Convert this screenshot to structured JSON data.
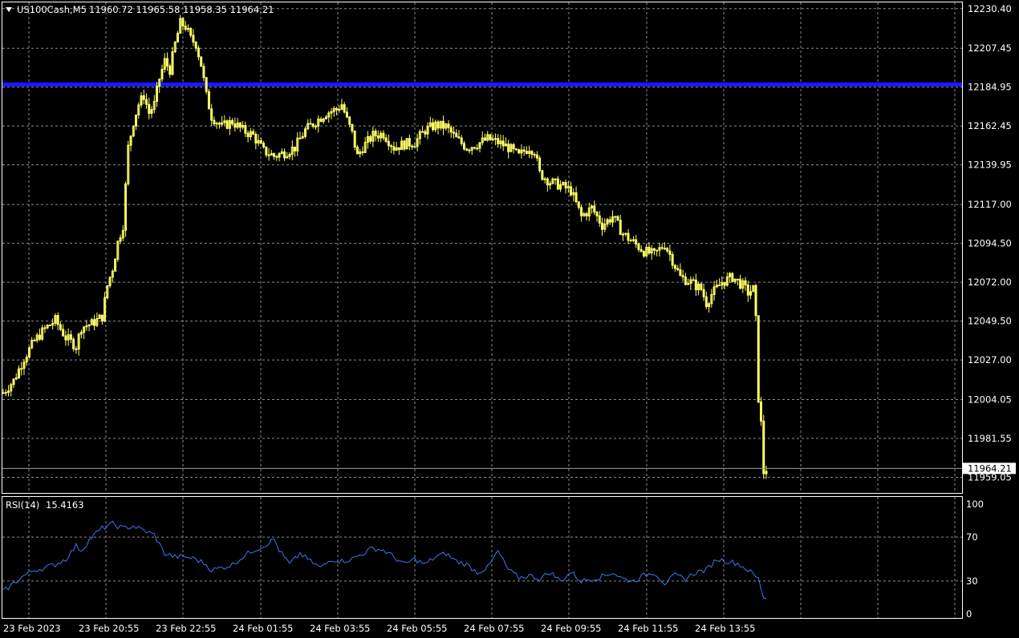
{
  "header": {
    "symbol": "US100Cash,M5",
    "ohlc": "11960.72 11965.58 11958.35 11964.21"
  },
  "colors": {
    "background": "#000000",
    "candle": "#ffff66",
    "hline": "#1a1aff",
    "rsi_line": "#3c78f0",
    "grid": "#8c8c8c"
  },
  "chart_data": [
    {
      "type": "candlestick",
      "name": "US100Cash M5",
      "ylim": [
        11950,
        12234
      ],
      "y_ticks": [
        "12230.40",
        "12207.45",
        "12184.95",
        "12162.45",
        "12139.95",
        "12117.00",
        "12094.50",
        "12072.00",
        "12049.50",
        "12027.00",
        "12004.05",
        "11981.55",
        "11959.05"
      ],
      "x_ticks": [
        "23 Feb 2023",
        "23 Feb 20:55",
        "23 Feb 22:55",
        "24 Feb 01:55",
        "24 Feb 03:55",
        "24 Feb 05:55",
        "24 Feb 07:55",
        "24 Feb 09:55",
        "24 Feb 11:55",
        "24 Feb 13:55"
      ],
      "current_price": "11964.21",
      "horizontal_line": 12186.5,
      "close_path": [
        [
          0,
          12008
        ],
        [
          4,
          12015
        ],
        [
          8,
          12028
        ],
        [
          12,
          12038
        ],
        [
          16,
          12045
        ],
        [
          20,
          12050
        ],
        [
          24,
          12040
        ],
        [
          28,
          12035
        ],
        [
          30,
          12046
        ],
        [
          34,
          12048
        ],
        [
          38,
          12052
        ],
        [
          40,
          12070
        ],
        [
          42,
          12080
        ],
        [
          44,
          12095
        ],
        [
          46,
          12105
        ],
        [
          48,
          12150
        ],
        [
          50,
          12165
        ],
        [
          52,
          12175
        ],
        [
          54,
          12180
        ],
        [
          56,
          12170
        ],
        [
          58,
          12175
        ],
        [
          60,
          12190
        ],
        [
          62,
          12200
        ],
        [
          64,
          12195
        ],
        [
          66,
          12210
        ],
        [
          68,
          12222
        ],
        [
          70,
          12220
        ],
        [
          72,
          12213
        ],
        [
          74,
          12210
        ],
        [
          76,
          12198
        ],
        [
          78,
          12180
        ],
        [
          80,
          12168
        ],
        [
          84,
          12162
        ],
        [
          88,
          12165
        ],
        [
          92,
          12160
        ],
        [
          96,
          12157
        ],
        [
          100,
          12148
        ],
        [
          104,
          12145
        ],
        [
          108,
          12147
        ],
        [
          112,
          12150
        ],
        [
          116,
          12160
        ],
        [
          120,
          12165
        ],
        [
          124,
          12170
        ],
        [
          128,
          12172
        ],
        [
          130,
          12175
        ],
        [
          132,
          12166
        ],
        [
          134,
          12158
        ],
        [
          136,
          12145
        ],
        [
          138,
          12150
        ],
        [
          142,
          12157
        ],
        [
          146,
          12158
        ],
        [
          150,
          12150
        ],
        [
          154,
          12152
        ],
        [
          158,
          12153
        ],
        [
          162,
          12160
        ],
        [
          166,
          12163
        ],
        [
          170,
          12162
        ],
        [
          174,
          12155
        ],
        [
          178,
          12150
        ],
        [
          182,
          12152
        ],
        [
          186,
          12155
        ],
        [
          190,
          12153
        ],
        [
          194,
          12150
        ],
        [
          198,
          12145
        ],
        [
          200,
          12148
        ],
        [
          202,
          12150
        ],
        [
          204,
          12148
        ],
        [
          206,
          12135
        ],
        [
          210,
          12130
        ],
        [
          214,
          12128
        ],
        [
          218,
          12125
        ],
        [
          222,
          12110
        ],
        [
          226,
          12115
        ],
        [
          230,
          12105
        ],
        [
          234,
          12110
        ],
        [
          238,
          12100
        ],
        [
          242,
          12095
        ],
        [
          246,
          12090
        ],
        [
          250,
          12088
        ],
        [
          254,
          12094
        ],
        [
          256,
          12088
        ],
        [
          260,
          12075
        ],
        [
          264,
          12072
        ],
        [
          268,
          12068
        ],
        [
          270,
          12060
        ],
        [
          272,
          12065
        ],
        [
          276,
          12072
        ],
        [
          280,
          12075
        ],
        [
          284,
          12070
        ],
        [
          286,
          12066
        ],
        [
          288,
          12068
        ],
        [
          289,
          12050
        ],
        [
          290,
          12005
        ],
        [
          291,
          11990
        ],
        [
          292,
          11962
        ],
        [
          293,
          11964
        ]
      ]
    },
    {
      "type": "line",
      "name": "RSI(14)",
      "value_label": "15.4163",
      "ylim": [
        0,
        100
      ],
      "y_ticks": [
        "100",
        "70",
        "30",
        "0"
      ],
      "levels": [
        70,
        30
      ],
      "values": [
        [
          0,
          20
        ],
        [
          4,
          28
        ],
        [
          8,
          35
        ],
        [
          12,
          40
        ],
        [
          16,
          42
        ],
        [
          20,
          45
        ],
        [
          24,
          50
        ],
        [
          28,
          62
        ],
        [
          30,
          58
        ],
        [
          34,
          70
        ],
        [
          38,
          78
        ],
        [
          42,
          82
        ],
        [
          46,
          78
        ],
        [
          50,
          80
        ],
        [
          54,
          76
        ],
        [
          58,
          72
        ],
        [
          62,
          55
        ],
        [
          66,
          52
        ],
        [
          70,
          52
        ],
        [
          74,
          50
        ],
        [
          78,
          45
        ],
        [
          80,
          40
        ],
        [
          84,
          42
        ],
        [
          88,
          45
        ],
        [
          92,
          52
        ],
        [
          96,
          58
        ],
        [
          100,
          62
        ],
        [
          104,
          68
        ],
        [
          106,
          58
        ],
        [
          110,
          45
        ],
        [
          114,
          55
        ],
        [
          118,
          48
        ],
        [
          122,
          42
        ],
        [
          126,
          50
        ],
        [
          130,
          48
        ],
        [
          134,
          50
        ],
        [
          138,
          55
        ],
        [
          142,
          60
        ],
        [
          146,
          58
        ],
        [
          150,
          52
        ],
        [
          154,
          45
        ],
        [
          158,
          50
        ],
        [
          162,
          45
        ],
        [
          166,
          52
        ],
        [
          170,
          55
        ],
        [
          174,
          48
        ],
        [
          178,
          45
        ],
        [
          182,
          38
        ],
        [
          186,
          42
        ],
        [
          190,
          57
        ],
        [
          194,
          40
        ],
        [
          198,
          33
        ],
        [
          202,
          35
        ],
        [
          206,
          32
        ],
        [
          210,
          38
        ],
        [
          214,
          30
        ],
        [
          218,
          38
        ],
        [
          222,
          30
        ],
        [
          226,
          32
        ],
        [
          230,
          34
        ],
        [
          234,
          38
        ],
        [
          238,
          32
        ],
        [
          242,
          30
        ],
        [
          246,
          35
        ],
        [
          250,
          38
        ],
        [
          254,
          28
        ],
        [
          258,
          35
        ],
        [
          262,
          32
        ],
        [
          266,
          38
        ],
        [
          270,
          40
        ],
        [
          274,
          50
        ],
        [
          278,
          48
        ],
        [
          282,
          46
        ],
        [
          286,
          40
        ],
        [
          290,
          32
        ],
        [
          292,
          15
        ],
        [
          293,
          15.4
        ]
      ]
    }
  ]
}
